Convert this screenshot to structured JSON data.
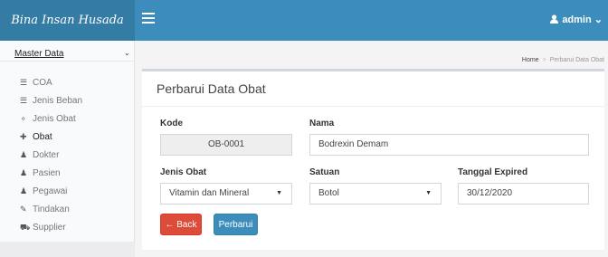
{
  "app": {
    "brand": "Bina Insan Husada"
  },
  "header": {
    "user_label": "admin",
    "user_caret": "⌄"
  },
  "sidebar": {
    "section_label": "Master Data",
    "section_caret": "⌄",
    "items": [
      {
        "label": "COA",
        "icon": "list-icon",
        "glyph": "☰"
      },
      {
        "label": "Jenis Beban",
        "icon": "list-icon",
        "glyph": "☰"
      },
      {
        "label": "Jenis Obat",
        "icon": "pills-icon",
        "glyph": "⚬"
      },
      {
        "label": "Obat",
        "icon": "capsule-icon",
        "glyph": "✚"
      },
      {
        "label": "Dokter",
        "icon": "user-md-icon",
        "glyph": "♟"
      },
      {
        "label": "Pasien",
        "icon": "user-icon",
        "glyph": "♟"
      },
      {
        "label": "Pegawai",
        "icon": "user-icon",
        "glyph": "♟"
      },
      {
        "label": "Tindakan",
        "icon": "syringe-icon",
        "glyph": "✎"
      },
      {
        "label": "Supplier",
        "icon": "truck-icon",
        "glyph": "⛟"
      }
    ]
  },
  "breadcrumb": {
    "home": "Home",
    "separator": ">",
    "current": "Perbarui Data Obat"
  },
  "form": {
    "title": "Perbarui Data Obat",
    "kode": {
      "label": "Kode",
      "value": "OB-0001"
    },
    "nama": {
      "label": "Nama",
      "value": "Bodrexin Demam"
    },
    "jenis_obat": {
      "label": "Jenis Obat",
      "value": "Vitamin dan Mineral"
    },
    "satuan": {
      "label": "Satuan",
      "value": "Botol"
    },
    "tanggal_expired": {
      "label": "Tanggal Expired",
      "value": "30/12/2020"
    },
    "back_label": "← Back",
    "save_label": "Perbarui",
    "select_caret": "▼"
  },
  "colors": {
    "header": "#3c8dbc",
    "brand_bg": "#357ca5",
    "back_button": "#dd4b39",
    "save_button": "#3c8dbc"
  }
}
